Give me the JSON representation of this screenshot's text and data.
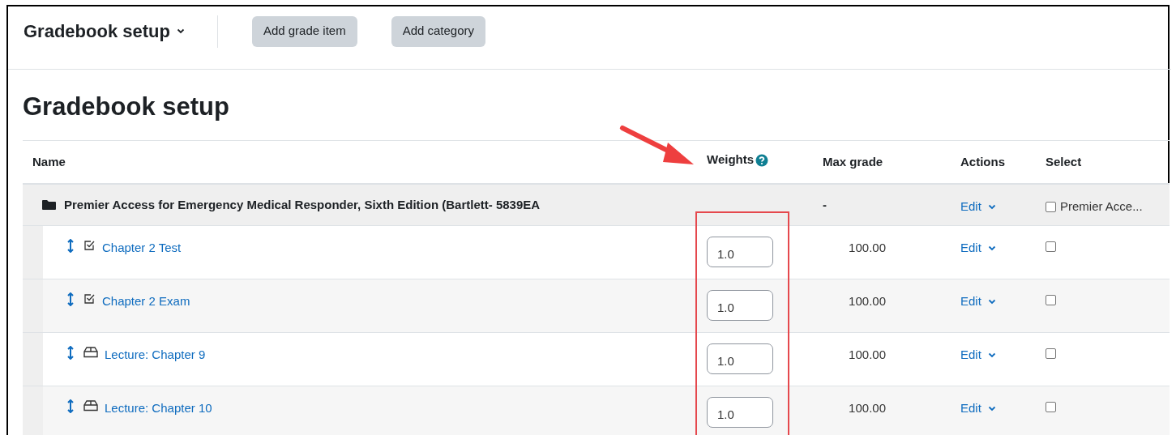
{
  "header": {
    "title": "Gradebook setup",
    "buttons": [
      "Add grade item",
      "Add category"
    ]
  },
  "page_title": "Gradebook setup",
  "table": {
    "columns": [
      "Name",
      "Weights",
      "Max grade",
      "Actions",
      "Select"
    ],
    "category": {
      "name": "Premier Access for Emergency Medical Responder, Sixth Edition (Bartlett- 5839EA",
      "max_grade": "-",
      "action": "Edit",
      "select_label": "Premier Acce...",
      "checked": false
    },
    "items": [
      {
        "name": "Chapter 2 Test",
        "kind": "quiz",
        "weight": "1.0",
        "max_grade": "100.00",
        "action": "Edit",
        "checked": false
      },
      {
        "name": "Chapter 2 Exam",
        "kind": "quiz",
        "weight": "1.0",
        "max_grade": "100.00",
        "action": "Edit",
        "checked": false
      },
      {
        "name": "Lecture: Chapter 9",
        "kind": "assign",
        "weight": "1.0",
        "max_grade": "100.00",
        "action": "Edit",
        "checked": false
      },
      {
        "name": "Lecture: Chapter 10",
        "kind": "assign",
        "weight": "1.0",
        "max_grade": "100.00",
        "action": "Edit",
        "checked": false
      }
    ]
  }
}
